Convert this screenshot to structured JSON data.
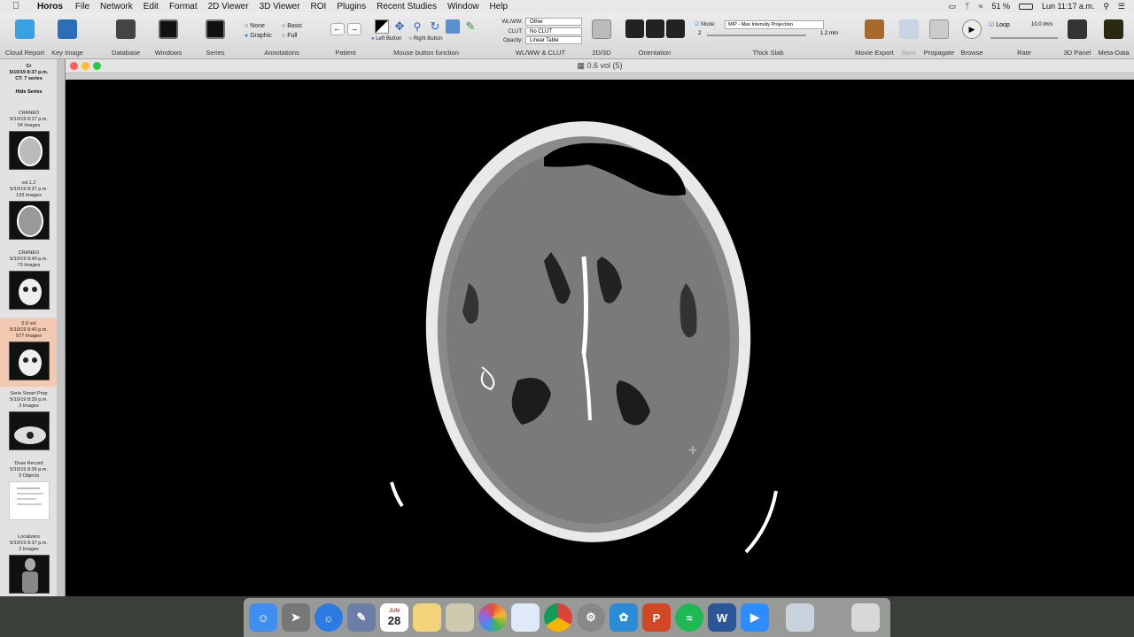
{
  "menubar": {
    "items": [
      "Horos",
      "File",
      "Network",
      "Edit",
      "Format",
      "2D Viewer",
      "3D Viewer",
      "ROI",
      "Plugins",
      "Recent Studies",
      "Window",
      "Help"
    ],
    "battery": "51 %",
    "clock": "Lun 11:17 a.m."
  },
  "toolbar": {
    "cloud_report": "Cloud Report",
    "key_image": "Key Image",
    "database": "Database",
    "windows": "Windows",
    "series": "Series",
    "annotations": "Annotations",
    "ann_none": "None",
    "ann_basic": "Basic",
    "ann_graphic": "Graphic",
    "ann_full": "Full",
    "patient": "Patient",
    "mouse_fn": "Mouse button function",
    "left_button": "Left Button",
    "right_button": "Right Button",
    "wlww_clut": "WL/WW & CLUT",
    "wlww_label": "WL/WW:",
    "wlww_value": "Other",
    "clut_label": "CLUT:",
    "clut_value": "No CLUT",
    "opacity_label": "Opacity:",
    "opacity_value": "Linear Table",
    "d2d3": "2D/3D",
    "orientation": "Orientation",
    "mode_label": "Mode:",
    "mode_value": "MIP - Max Intensity Projection",
    "thick_num": "2",
    "thick_mm": "1.2 mm",
    "thick_slab": "Thick Slab",
    "movie_export": "Movie Export",
    "sync": "Sync",
    "propagate": "Propagate",
    "browse": "Browse",
    "loop": "Loop",
    "rate_value": "10.0 im/s",
    "rate": "Rate",
    "panel3d": "3D Panel",
    "metadata": "Meta-Data"
  },
  "window": {
    "title": "0.6 vol (5)"
  },
  "study": {
    "header_line1": "Cr",
    "header_line2": "5/10/19 8:37 p.m.",
    "header_line3": "CT: 7 series",
    "hide_series": "Hide Series"
  },
  "series": [
    {
      "name": "CRANEO",
      "date": "5/10/19 8:37 p.m.",
      "count": "34 Images"
    },
    {
      "name": "vol.1.2",
      "date": "5/10/19 8:37 p.m.",
      "count": "133 Images"
    },
    {
      "name": "CRANEO",
      "date": "5/10/19 8:40 p.m.",
      "count": "73 Images"
    },
    {
      "name": "0.6 vol",
      "date": "5/10/19 8:40 p.m.",
      "count": "577 Images"
    },
    {
      "name": "Serie Smart Prep",
      "date": "5/10/19 8:39 p.m.",
      "count": "3 Images"
    },
    {
      "name": "Dose Record",
      "date": "5/10/19 8:36 p.m.",
      "count": "3 Objects"
    },
    {
      "name": "Localizers",
      "date": "5/10/19 8:37 p.m.",
      "count": "2 Images"
    }
  ],
  "dock": {
    "calendar_day": "28",
    "calendar_month": "JUN"
  },
  "colors": {
    "selected_series": "#f4c9b2",
    "accent": "#3a7bd5"
  }
}
